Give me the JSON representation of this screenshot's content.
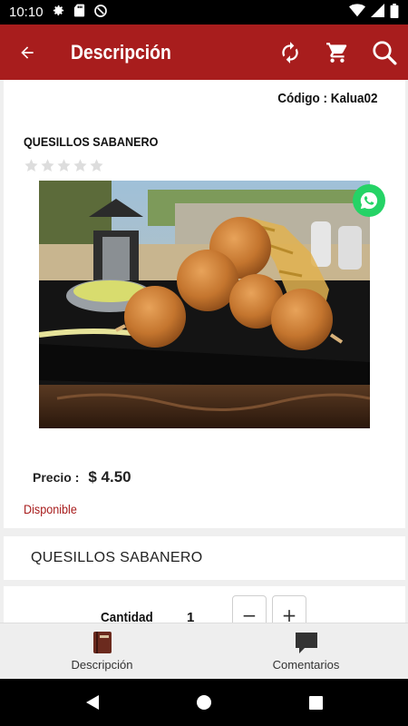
{
  "status": {
    "time": "10:10"
  },
  "header": {
    "title": "Descripción"
  },
  "product": {
    "code_label": "Código : Kalua02",
    "name": "QUESILLOS SABANERO",
    "rating": 0,
    "price_label": "Precio :",
    "price": "$ 4.50",
    "availability": "Disponible",
    "description": "QUESILLOS SABANERO"
  },
  "quantity": {
    "label": "Cantidad",
    "value": "1",
    "minus": "−",
    "plus": "+"
  },
  "tabs": [
    {
      "label": "Descripción",
      "icon": "book-icon"
    },
    {
      "label": "Comentarios",
      "icon": "comment-icon"
    }
  ],
  "colors": {
    "primary": "#a81d1d",
    "whatsapp": "#25d366",
    "star_empty": "#dddddd"
  }
}
